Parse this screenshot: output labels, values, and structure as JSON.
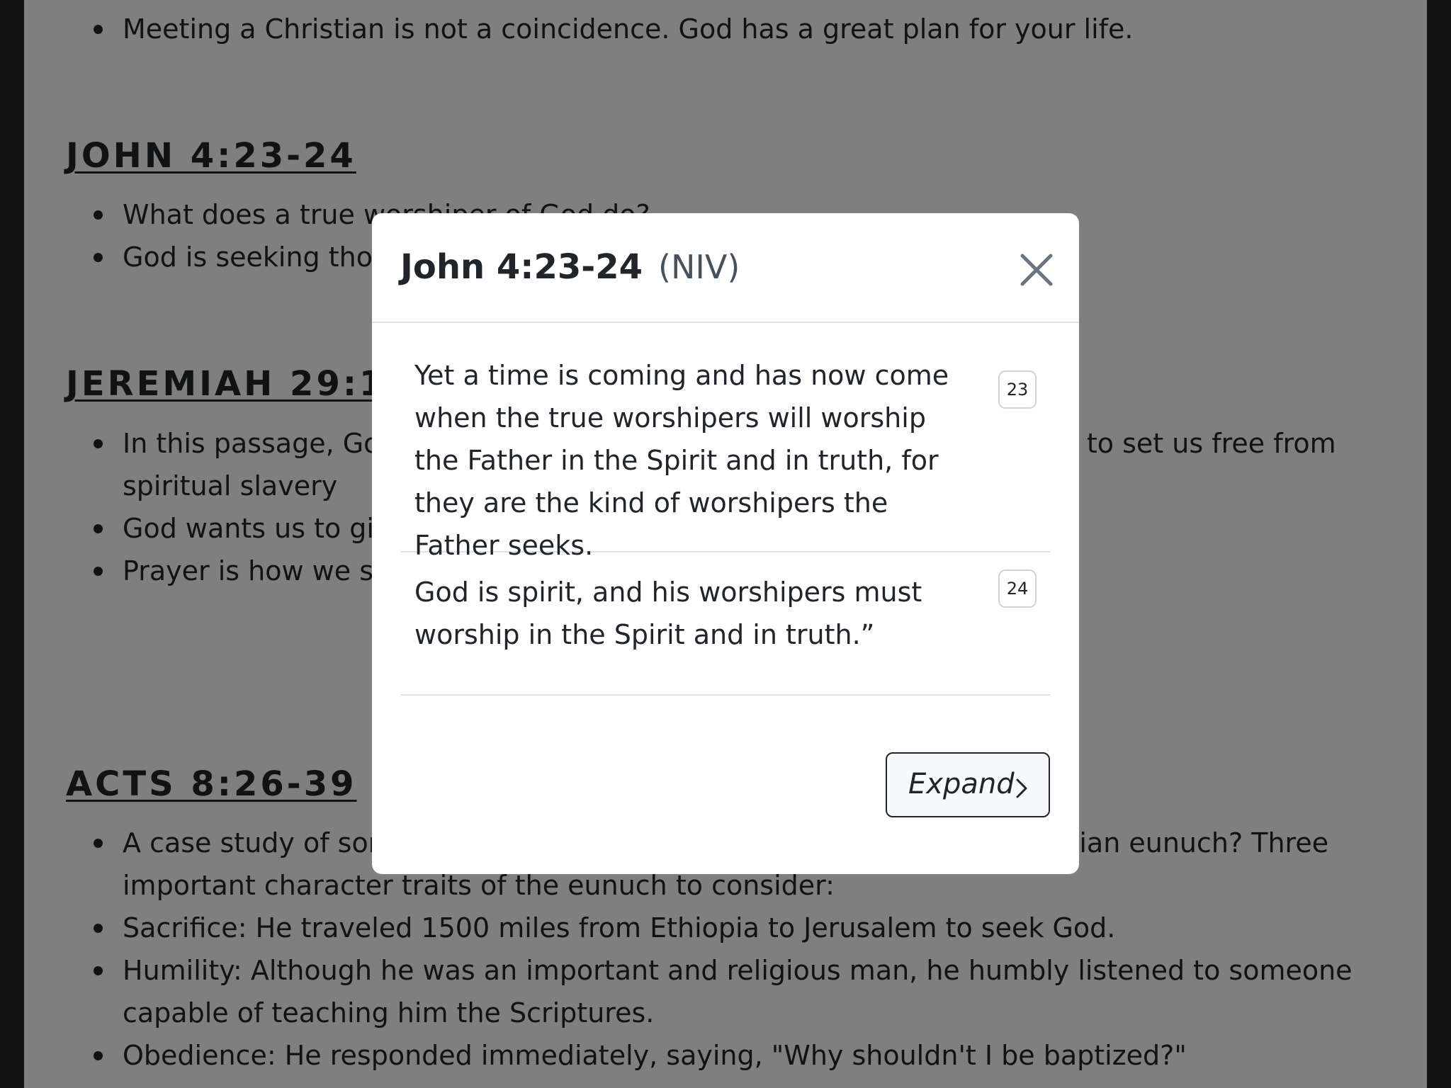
{
  "background_page": {
    "sections": [
      {
        "heading": "",
        "bullets": [
          "Meeting a Christian is not a coincidence. God has a great plan for your life."
        ]
      },
      {
        "heading": "JOHN 4:23-24",
        "bullets": [
          "What does a true worshiper of God do?",
          "God is seeking those"
        ]
      },
      {
        "heading": "JEREMIAH 29:1",
        "bullets": [
          "In this passage, God ... ptivity to their oppressors. In the sa... od wants to set us free from spiritual slavery",
          "God wants us to giv... st first draw near to Him. The only way t",
          "Prayer is how we see"
        ]
      },
      {
        "heading": "ACTS 8:26-39",
        "bullets": [
          "A case study of som... an eunuch? Are you seeking God like this Ethiopian eunuch? Three important character traits of the eunuch to consider:",
          "Sacrifice: He traveled 1500 miles from Ethiopia to Jerusalem to seek God.",
          "Humility: Although he was an important and religious man, he humbly listened to someone capable of teaching him the Scriptures.",
          "Obedience: He responded immediately, saying, \"Why shouldn't I be baptized?\""
        ]
      }
    ]
  },
  "modal": {
    "title": "John 4:23-24",
    "version": "(NIV)",
    "close_icon": "close-icon",
    "verses": [
      {
        "number": "23",
        "text": "Yet a time is coming and has now come when the true worshipers will worship the Father in the Spirit and in truth, for they are the kind of worshipers the Father seeks."
      },
      {
        "number": "24",
        "text": "God is spirit, and his worshipers must worship in the Spirit and in truth.”"
      }
    ],
    "expand_label": "Expand",
    "expand_icon": "chevron-right-icon"
  },
  "colors": {
    "backdrop": "#000000",
    "page_background": "#ffffff",
    "text": "#212529",
    "divider": "#dee2e6"
  }
}
